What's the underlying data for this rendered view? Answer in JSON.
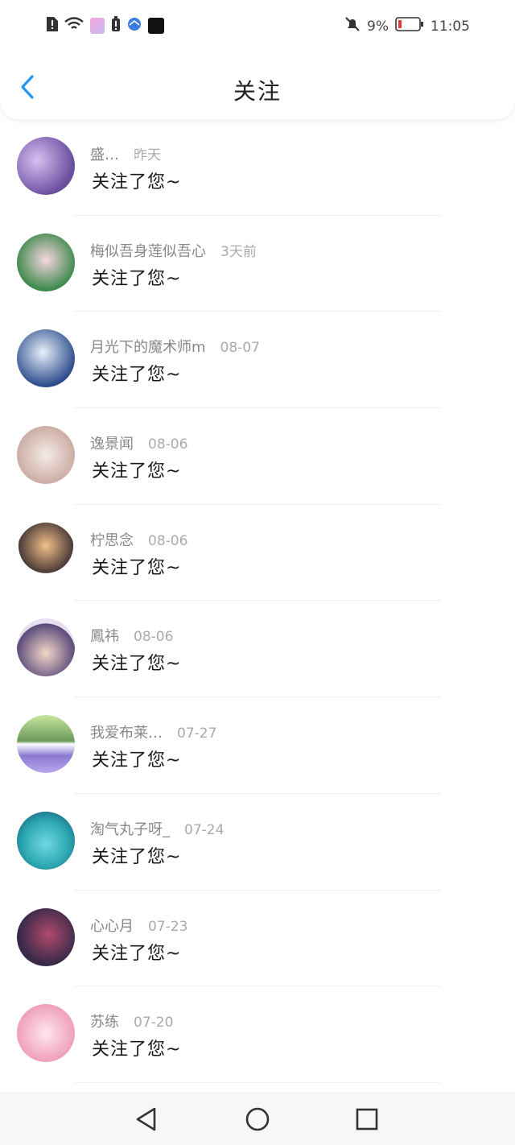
{
  "status_bar": {
    "battery_percent": "9%",
    "time": "11:05",
    "icons": [
      "alert-icon",
      "wifi-icon",
      "app-icon",
      "battery-alert-icon",
      "browser-icon",
      "notification-icon",
      "mute-icon"
    ]
  },
  "header": {
    "title": "关注",
    "back_icon": "chevron-left-icon"
  },
  "items": [
    {
      "name": "盛…",
      "time": "昨天",
      "message": "关注了您~",
      "avatar_color": "#6a4fa0"
    },
    {
      "name": "梅似吾身莲似吾心",
      "time": "3天前",
      "message": "关注了您~",
      "avatar_color": "#3f8a4d"
    },
    {
      "name": "月光下的魔术师m",
      "time": "08-07",
      "message": "关注了您~",
      "avatar_color": "#2a4a8a"
    },
    {
      "name": "逸景闻",
      "time": "08-06",
      "message": "关注了您~",
      "avatar_color": "#c9a9a0"
    },
    {
      "name": "柠思念",
      "time": "08-06",
      "message": "关注了您~",
      "avatar_color": "#4a3a36"
    },
    {
      "name": "鳳祎",
      "time": "08-06",
      "message": "关注了您~",
      "avatar_color": "#5a4a7a"
    },
    {
      "name": "我爱布莱…",
      "time": "07-27",
      "message": "关注了您~",
      "avatar_color": "#6a9a5a"
    },
    {
      "name": "淘气丸子呀_",
      "time": "07-24",
      "message": "关注了您~",
      "avatar_color": "#2aa6b0"
    },
    {
      "name": "心心月",
      "time": "07-23",
      "message": "关注了您~",
      "avatar_color": "#3a2a4a"
    },
    {
      "name": "苏练",
      "time": "07-20",
      "message": "关注了您~",
      "avatar_color": "#f0a0b8"
    }
  ],
  "nav": {
    "back_icon": "triangle-back-icon",
    "home_icon": "circle-home-icon",
    "recent_icon": "square-recent-icon"
  },
  "colors": {
    "accent": "#2196f3",
    "name_gray": "#888888",
    "time_gray": "#aaaaaa"
  }
}
